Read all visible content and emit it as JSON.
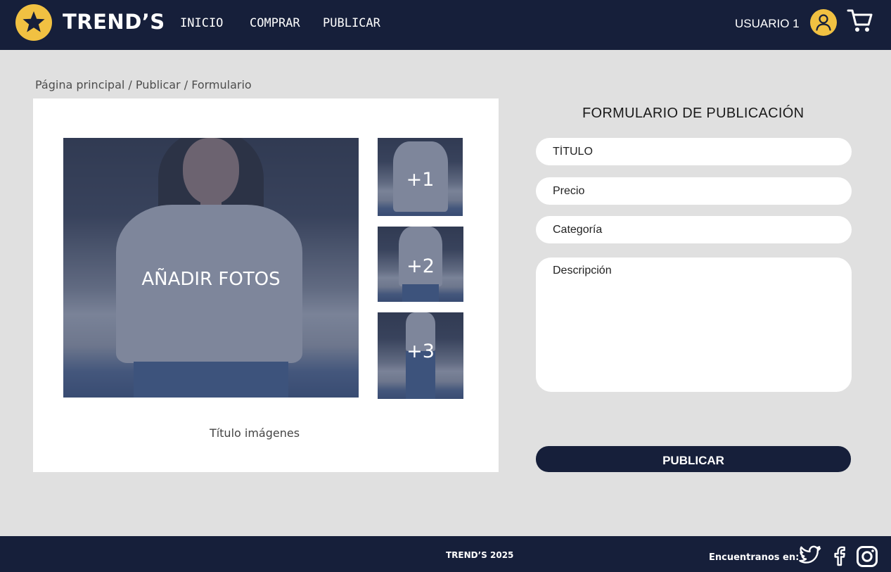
{
  "header": {
    "brand": "TREND’S",
    "nav": [
      "INICIO",
      "COMPRAR",
      "PUBLICAR"
    ],
    "user": "USUARIO 1"
  },
  "breadcrumb": "Página principal / Publicar / Formulario",
  "gallery": {
    "main_label": "AÑADIR FOTOS",
    "thumbs": [
      "+1",
      "+2",
      "+3"
    ],
    "images_title": "Título imágenes"
  },
  "form": {
    "title": "FORMULARIO DE PUBLICACIÓN",
    "fields": {
      "title_placeholder": "TÍTULO",
      "price_placeholder": "Precio",
      "category_placeholder": "Categoría",
      "description_placeholder": "Descripción"
    },
    "submit": "PUBLICAR"
  },
  "footer": {
    "copyright": "TREND’S 2025",
    "find_us": "Encuentranos en:",
    "social_icons": [
      "twitter-icon",
      "facebook-icon",
      "instagram-icon"
    ]
  },
  "colors": {
    "navy": "#161f3a",
    "accent_yellow": "#f1c142",
    "background": "#e0e0e0",
    "photo_overlay": "#364262"
  }
}
